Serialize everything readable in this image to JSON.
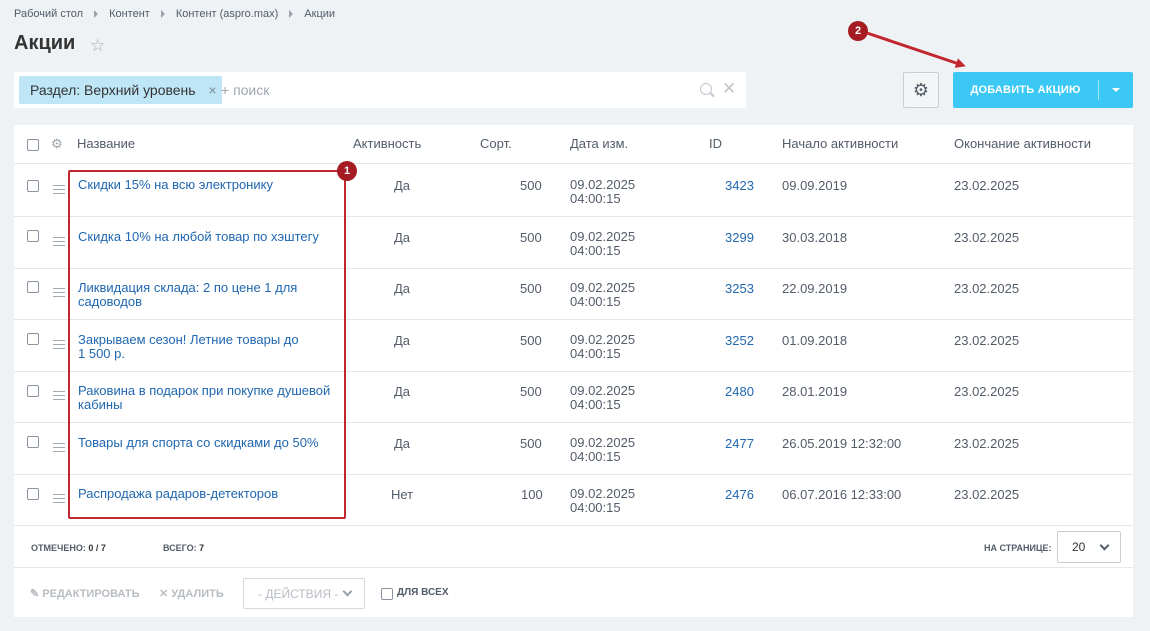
{
  "breadcrumbs": [
    "Рабочий стол",
    "Контент",
    "Контент (aspro.max)",
    "Акции"
  ],
  "page_title": "Акции",
  "filter": {
    "chip_label": "Раздел: Верхний уровень",
    "chip_close": "×",
    "search_placeholder": "+ поиск",
    "clear": "✕"
  },
  "settings_icon": "⚙",
  "add_button": {
    "label": "ДОБАВИТЬ АКЦИЮ"
  },
  "columns": {
    "name": "Название",
    "active": "Активность",
    "sort": "Сорт.",
    "date": "Дата изм.",
    "id": "ID",
    "start": "Начало активности",
    "end": "Окончание активности"
  },
  "rows": [
    {
      "name": "Скидки 15% на всю электронику",
      "active": "Да",
      "sort": "500",
      "date1": "09.02.2025",
      "date2": "04:00:15",
      "id": "3423",
      "start": "09.09.2019",
      "end": "23.02.2025"
    },
    {
      "name": "Скидка 10% на любой товар по хэштегу",
      "active": "Да",
      "sort": "500",
      "date1": "09.02.2025",
      "date2": "04:00:15",
      "id": "3299",
      "start": "30.03.2018",
      "end": "23.02.2025"
    },
    {
      "name": "Ликвидация склада: 2 по цене 1 для садоводов",
      "active": "Да",
      "sort": "500",
      "date1": "09.02.2025",
      "date2": "04:00:15",
      "id": "3253",
      "start": "22.09.2019",
      "end": "23.02.2025"
    },
    {
      "name": "Закрываем сезон! Летние товары до 1 500 р.",
      "active": "Да",
      "sort": "500",
      "date1": "09.02.2025",
      "date2": "04:00:15",
      "id": "3252",
      "start": "01.09.2018",
      "end": "23.02.2025"
    },
    {
      "name": "Раковина в подарок при покупке душевой кабины",
      "active": "Да",
      "sort": "500",
      "date1": "09.02.2025",
      "date2": "04:00:15",
      "id": "2480",
      "start": "28.01.2019",
      "end": "23.02.2025"
    },
    {
      "name": "Товары для спорта со скидками до 50%",
      "active": "Да",
      "sort": "500",
      "date1": "09.02.2025",
      "date2": "04:00:15",
      "id": "2477",
      "start": "26.05.2019 12:32:00",
      "end": "23.02.2025"
    },
    {
      "name": "Распродажа радаров-детекторов",
      "active": "Нет",
      "sort": "100",
      "date1": "09.02.2025",
      "date2": "04:00:15",
      "id": "2476",
      "start": "06.07.2016 12:33:00",
      "end": "23.02.2025"
    }
  ],
  "footer": {
    "selected_label": "ОТМЕЧЕНО:",
    "selected_value": "0 / 7",
    "total_label": "ВСЕГО:",
    "total_value": "7",
    "per_page_label": "НА СТРАНИЦЕ:",
    "per_page_value": "20"
  },
  "actions": {
    "edit": "✎ РЕДАКТИРОВАТЬ",
    "delete": "✕ УДАЛИТЬ",
    "select": "- ДЕЙСТВИЯ -",
    "all": "ДЛЯ ВСЕХ"
  },
  "annotations": {
    "badge1": "1",
    "badge2": "2",
    "color": "#c2262e"
  }
}
